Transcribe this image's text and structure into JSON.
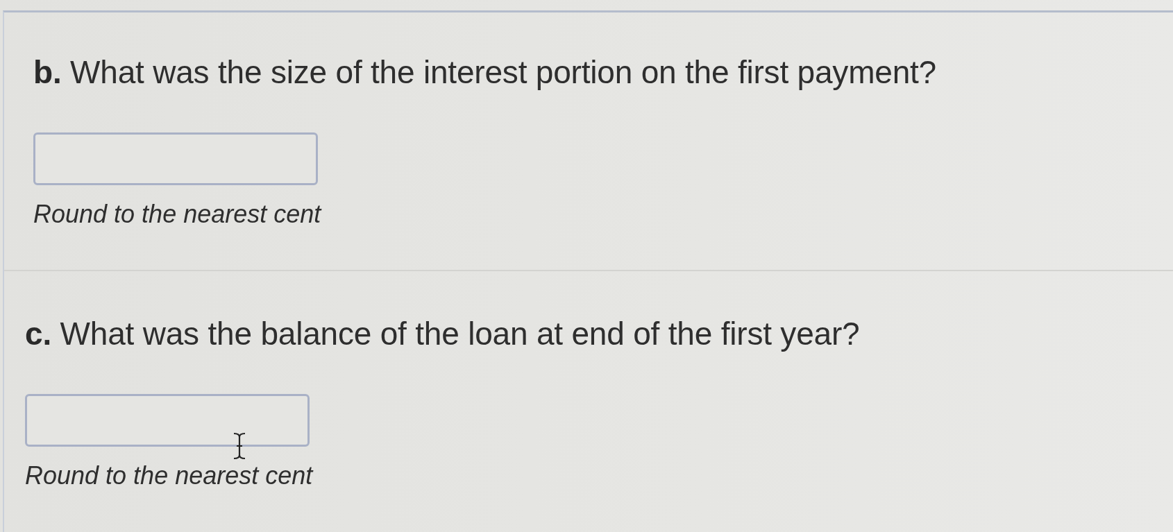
{
  "questions": [
    {
      "prompt": "**b.** What was the size of the interest portion on the first payment?",
      "hint": "Round to the nearest cent"
    },
    {
      "prompt": "**c.** What was the balance of the loan at end of the first year?",
      "hint": "Round to the nearest cent"
    }
  ]
}
